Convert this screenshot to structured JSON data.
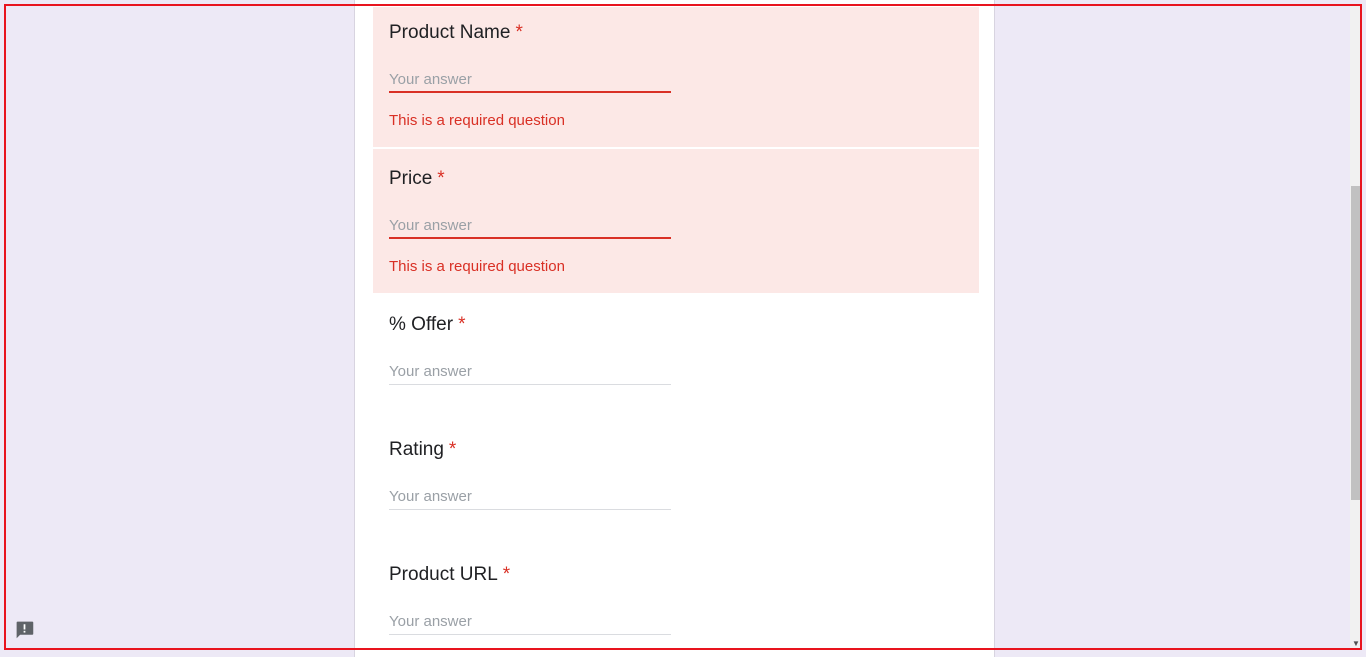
{
  "form": {
    "placeholder": "Your answer",
    "required_mark": "*",
    "error_message": "This is a required question",
    "questions": [
      {
        "title": "Product Name",
        "state": "error"
      },
      {
        "title": "Price",
        "state": "error"
      },
      {
        "title": "% Offer",
        "state": "normal"
      },
      {
        "title": "Rating",
        "state": "normal"
      },
      {
        "title": "Product URL",
        "state": "normal"
      }
    ]
  },
  "icons": {
    "report": "report-problem-icon",
    "scroll_down": "scroll-down-arrow-icon"
  },
  "colors": {
    "page_background": "#ede9f6",
    "error": "#d93025",
    "error_background": "#fce8e6",
    "card": "#ffffff"
  }
}
